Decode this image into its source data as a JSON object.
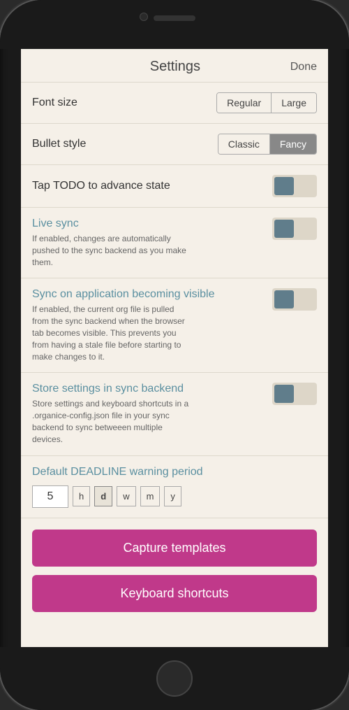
{
  "header": {
    "title": "Settings",
    "done_label": "Done"
  },
  "font_size": {
    "label": "Font size",
    "options": [
      "Regular",
      "Large"
    ],
    "selected": "Regular"
  },
  "bullet_style": {
    "label": "Bullet style",
    "options": [
      "Classic",
      "Fancy"
    ],
    "selected": "Fancy"
  },
  "tap_todo": {
    "label": "Tap TODO to advance state",
    "enabled": true
  },
  "live_sync": {
    "label": "Live sync",
    "description": "If enabled, changes are automatically pushed to the sync backend as you make them.",
    "enabled": true
  },
  "sync_visible": {
    "label": "Sync on application becoming visible",
    "description": "If enabled, the current org file is pulled from the sync backend when the browser tab becomes visible. This prevents you from having a stale file before starting to make changes to it.",
    "enabled": true
  },
  "store_settings": {
    "label": "Store settings in sync backend",
    "description": "Store settings and keyboard shortcuts in a .organice-config.json file in your sync backend to sync betweeen multiple devices.",
    "enabled": true
  },
  "deadline": {
    "label": "Default DEADLINE warning period",
    "value": "5",
    "units": [
      "h",
      "d",
      "w",
      "m",
      "y"
    ],
    "selected_unit": "d"
  },
  "buttons": {
    "capture_templates": "Capture templates",
    "keyboard_shortcuts": "Keyboard shortcuts"
  }
}
